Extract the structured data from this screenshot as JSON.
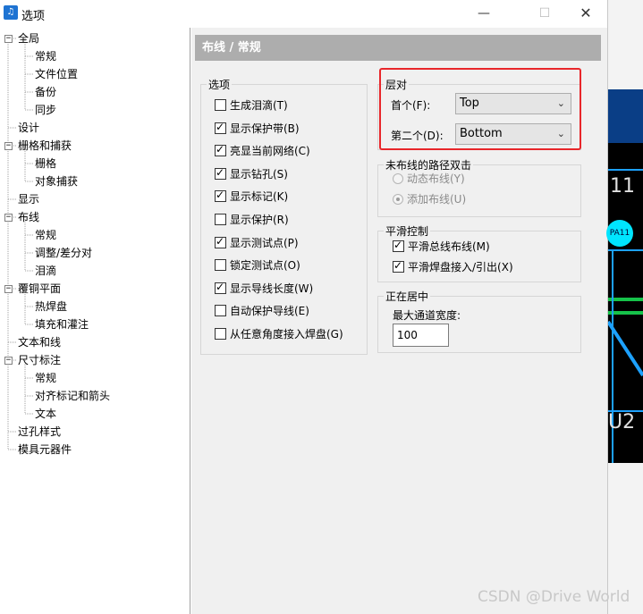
{
  "window": {
    "title": "选项",
    "app_icon": "music-note-icon",
    "minimize_icon": "—",
    "maximize_icon": "☐",
    "close_icon": "✕"
  },
  "tree": {
    "items": [
      {
        "label": "全局",
        "level": 0,
        "expander": "−"
      },
      {
        "label": "常规",
        "level": 1
      },
      {
        "label": "文件位置",
        "level": 1
      },
      {
        "label": "备份",
        "level": 1
      },
      {
        "label": "同步",
        "level": 1
      },
      {
        "label": "设计",
        "level": 0
      },
      {
        "label": "栅格和捕获",
        "level": 0,
        "expander": "−"
      },
      {
        "label": "栅格",
        "level": 1
      },
      {
        "label": "对象捕获",
        "level": 1
      },
      {
        "label": "显示",
        "level": 0
      },
      {
        "label": "布线",
        "level": 0,
        "expander": "−"
      },
      {
        "label": "常规",
        "level": 1
      },
      {
        "label": "调整/差分对",
        "level": 1
      },
      {
        "label": "泪滴",
        "level": 1
      },
      {
        "label": "覆铜平面",
        "level": 0,
        "expander": "−"
      },
      {
        "label": "热焊盘",
        "level": 1
      },
      {
        "label": "填充和灌注",
        "level": 1
      },
      {
        "label": "文本和线",
        "level": 0
      },
      {
        "label": "尺寸标注",
        "level": 0,
        "expander": "−"
      },
      {
        "label": "常规",
        "level": 1
      },
      {
        "label": "对齐标记和箭头",
        "level": 1
      },
      {
        "label": "文本",
        "level": 1
      },
      {
        "label": "过孔样式",
        "level": 0
      },
      {
        "label": "模具元器件",
        "level": 0
      }
    ]
  },
  "panel": {
    "header": "布线 / 常规",
    "options_group": {
      "title": "选项",
      "checkboxes": [
        {
          "label": "生成泪滴(T)",
          "checked": false
        },
        {
          "label": "显示保护带(B)",
          "checked": true
        },
        {
          "label": "亮显当前网络(C)",
          "checked": true
        },
        {
          "label": "显示钻孔(S)",
          "checked": true
        },
        {
          "label": "显示标记(K)",
          "checked": true
        },
        {
          "label": "显示保护(R)",
          "checked": false
        },
        {
          "label": "显示测试点(P)",
          "checked": true
        },
        {
          "label": "锁定测试点(O)",
          "checked": false
        },
        {
          "label": "显示导线长度(W)",
          "checked": true
        },
        {
          "label": "自动保护导线(E)",
          "checked": false
        },
        {
          "label": "从任意角度接入焊盘(G)",
          "checked": false
        }
      ]
    },
    "layer_pair": {
      "title": "层对",
      "first_label": "首个(F):",
      "first_value": "Top",
      "second_label": "第二个(D):",
      "second_value": "Bottom"
    },
    "unrouted_group": {
      "title": "未布线的路径双击",
      "radios": [
        {
          "label": "动态布线(Y)",
          "selected": false
        },
        {
          "label": "添加布线(U)",
          "selected": true
        }
      ]
    },
    "smooth_group": {
      "title": "平滑控制",
      "checkboxes": [
        {
          "label": "平滑总线布线(M)",
          "checked": true
        },
        {
          "label": "平滑焊盘接入/引出(X)",
          "checked": true
        }
      ]
    },
    "centering_group": {
      "title": "正在居中",
      "label": "最大通道宽度:",
      "value": "100"
    }
  },
  "background_app": {
    "text_11": "11",
    "pad_label": "PA11",
    "text_u2": "U2"
  },
  "watermark": "CSDN @Drive World",
  "colors": {
    "highlight": "#e8262a",
    "header_bg": "#adadad",
    "panel_bg": "#f0f0f0"
  }
}
